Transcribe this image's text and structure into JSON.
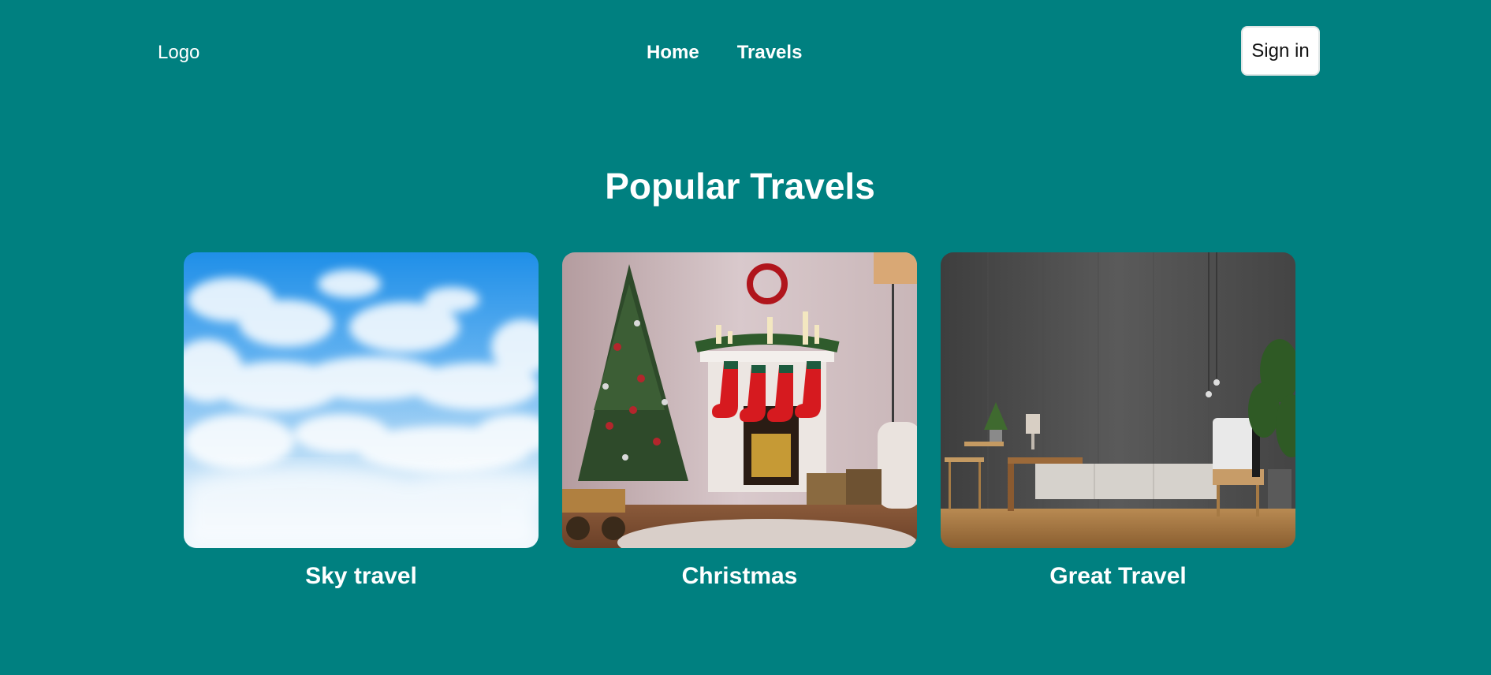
{
  "header": {
    "logo": "Logo",
    "nav": [
      {
        "label": "Home"
      },
      {
        "label": "Travels"
      }
    ],
    "signin_label": "Sign in"
  },
  "main": {
    "title": "Popular Travels",
    "cards": [
      {
        "title": "Sky travel",
        "image": "sky-with-clouds"
      },
      {
        "title": "Christmas",
        "image": "christmas-living-room"
      },
      {
        "title": "Great Travel",
        "image": "modern-interior-concrete-wall"
      }
    ]
  },
  "colors": {
    "background": "#008080",
    "text": "#ffffff",
    "button_bg": "#ffffff",
    "button_text": "#111111"
  }
}
